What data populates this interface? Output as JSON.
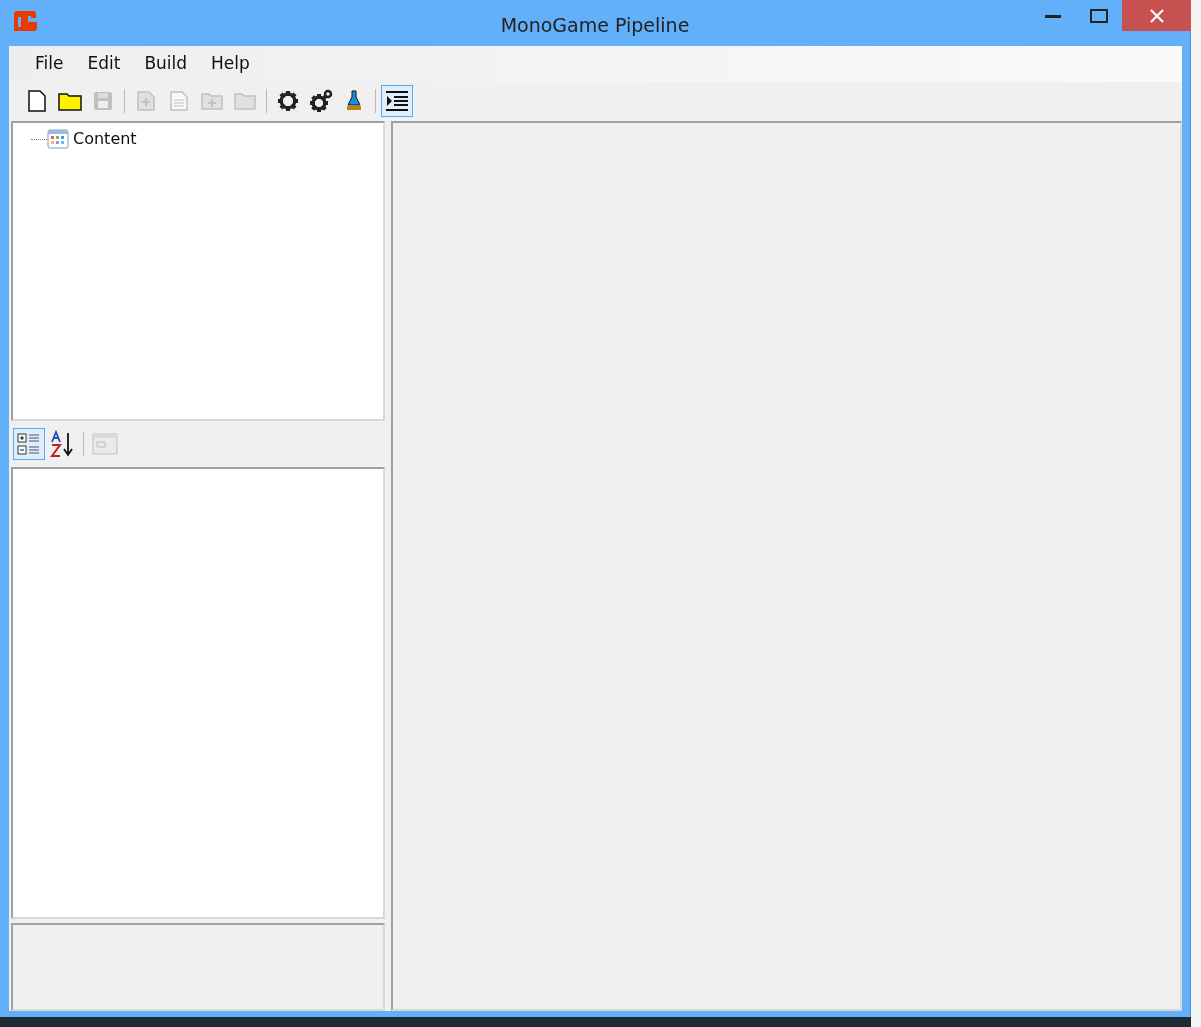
{
  "window": {
    "title": "MonoGame Pipeline"
  },
  "menu": [
    {
      "label": "File"
    },
    {
      "label": "Edit"
    },
    {
      "label": "Build"
    },
    {
      "label": "Help"
    }
  ],
  "toolbar": [
    [
      {
        "kind": "new",
        "disabled": false,
        "selected": false
      },
      {
        "kind": "open",
        "disabled": false,
        "selected": false
      },
      {
        "kind": "save",
        "disabled": true,
        "selected": false
      }
    ],
    [
      {
        "kind": "add-item",
        "disabled": true,
        "selected": false
      },
      {
        "kind": "new-item",
        "disabled": true,
        "selected": false
      },
      {
        "kind": "add-folder",
        "disabled": true,
        "selected": false
      },
      {
        "kind": "new-folder",
        "disabled": true,
        "selected": false
      }
    ],
    [
      {
        "kind": "build",
        "disabled": false,
        "selected": false
      },
      {
        "kind": "rebuild",
        "disabled": false,
        "selected": false
      },
      {
        "kind": "clean",
        "disabled": false,
        "selected": false
      }
    ],
    [
      {
        "kind": "filter",
        "disabled": false,
        "selected": true
      }
    ]
  ],
  "tree": [
    {
      "label": "Content"
    }
  ],
  "property_toolbar": [
    [
      {
        "kind": "categorized",
        "disabled": false,
        "selected": true
      },
      {
        "kind": "alphabetical",
        "disabled": false,
        "selected": false
      }
    ],
    [
      {
        "kind": "property-pages",
        "disabled": true,
        "selected": false
      }
    ]
  ]
}
